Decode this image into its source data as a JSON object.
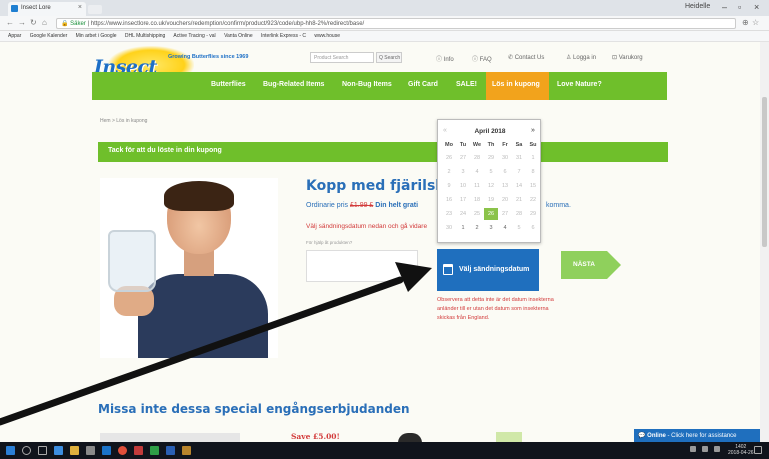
{
  "browser": {
    "tab_title": "Insect Lore",
    "user": "Heidelle",
    "url_secure": "Säker",
    "url": "https://www.insectlore.co.uk/vouchers/redemption/confirm/product/923/code/ubp-hh8-2%/redirect/base/",
    "bookmarks": [
      "Appar",
      "Google Kalender",
      "Min arbet i Google",
      "DHL Multishipping",
      "Active Tracing - val",
      "Vanta Online",
      "Interlink Express - C",
      "www.house"
    ]
  },
  "site": {
    "logo": "Insect Lore",
    "tagline": "Growing Butterflies since 1969",
    "search_placeholder": "Product Search",
    "search_button": "Q Search",
    "top_links": [
      "ⓘ Info",
      "ⓘ FAQ",
      "✆ Contact Us",
      "♙ Logga in",
      "⊡ Varukorg"
    ]
  },
  "nav": {
    "items": [
      "Butterflies",
      "Bug-Related Items",
      "Non-Bug Items",
      "Gift Card",
      "SALE!",
      "Lös in kupong",
      "Love Nature?"
    ]
  },
  "breadcrumb": "Hem  >  Lös in kupong",
  "banner": "Tack för att du löste in din kupong",
  "product": {
    "heading": "Kopp med fjärilslarver o",
    "price_prefix": "Ordinarie pris ",
    "price_old": "£1.99 £",
    "price_free": "Din helt grati",
    "price_tail": "komma.",
    "prompt": "Välj sändningsdatum nedan och gå vidare",
    "field_label": "För hjälp åt produkten?",
    "date_button": "Välj sändningsdatum",
    "next_button": "NÄSTA",
    "note": "Observera att detta inte är det datum insekterna anländer till er utan det datum som insekterna skickas från England."
  },
  "datepicker": {
    "month": "April 2018",
    "prev": "«",
    "next": "»",
    "weekdays": [
      "Mo",
      "Tu",
      "We",
      "Th",
      "Fr",
      "Sa",
      "Su"
    ],
    "days": [
      [
        "26",
        "27",
        "28",
        "29",
        "30",
        "31",
        "1"
      ],
      [
        "2",
        "3",
        "4",
        "5",
        "6",
        "7",
        "8"
      ],
      [
        "9",
        "10",
        "11",
        "12",
        "13",
        "14",
        "15"
      ],
      [
        "16",
        "17",
        "18",
        "19",
        "20",
        "21",
        "22"
      ],
      [
        "23",
        "24",
        "25",
        "26",
        "27",
        "28",
        "29"
      ],
      [
        "30",
        "1",
        "2",
        "3",
        "4",
        "5",
        "6"
      ]
    ],
    "today": "26",
    "available": [
      "1",
      "2",
      "3",
      "4"
    ]
  },
  "specials": {
    "heading": "Missa inte dessa special engångserbjudanden",
    "save": "Save £5.00!"
  },
  "chat": {
    "status": "Online",
    "text": " - Click here for assistance"
  },
  "taskbar": {
    "time": "1402",
    "date": "2018-04-26"
  }
}
